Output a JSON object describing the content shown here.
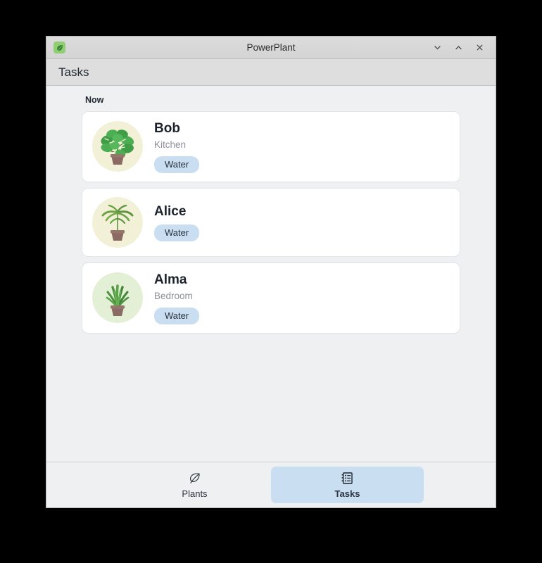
{
  "window": {
    "title": "PowerPlant",
    "app_icon": "leaf-icon",
    "controls": [
      {
        "name": "minimize",
        "glyph": "∨"
      },
      {
        "name": "maximize",
        "glyph": "∧"
      },
      {
        "name": "close",
        "glyph": "✕"
      }
    ]
  },
  "header": {
    "title": "Tasks"
  },
  "content": {
    "section_label": "Now",
    "tasks": [
      {
        "name": "Bob",
        "location": "Kitchen",
        "badge": "Water",
        "plant_icon": "monstera-plant",
        "avatar_bg": "#f2f1d8"
      },
      {
        "name": "Alice",
        "location": "",
        "badge": "Water",
        "plant_icon": "palm-plant",
        "avatar_bg": "#f2f1d8"
      },
      {
        "name": "Alma",
        "location": "Bedroom",
        "badge": "Water",
        "plant_icon": "aloe-plant",
        "avatar_bg": "#e4f0d5"
      }
    ]
  },
  "bottom_nav": {
    "items": [
      {
        "label": "Plants",
        "icon": "leaf-outline-icon",
        "active": false
      },
      {
        "label": "Tasks",
        "icon": "list-notebook-icon",
        "active": true
      }
    ]
  },
  "colors": {
    "accent_badge": "#c9dff1",
    "card_bg": "#ffffff",
    "window_bg": "#eff0f1",
    "titlebar_bg": "#d6d6d6"
  }
}
